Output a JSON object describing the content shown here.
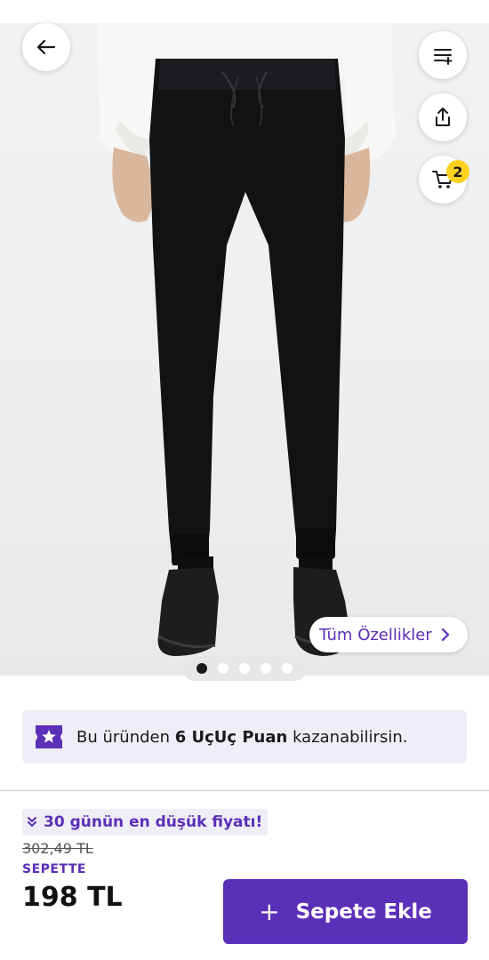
{
  "header": {
    "back_icon": "arrow-left-icon",
    "filter_icon": "list-add-icon",
    "share_icon": "share-icon",
    "cart_icon": "cart-icon",
    "cart_count": "2"
  },
  "gallery": {
    "specs_label": "Tüm Özellikler",
    "image_count": 5,
    "active_index": 0
  },
  "points": {
    "prefix": "Bu üründen ",
    "amount": "6 UçUç Puan",
    "suffix": " kazanabilirsin."
  },
  "pricing": {
    "lowest_label": "30 günün en düşük fiyatı!",
    "old_price": "302,49 TL",
    "cart_label": "SEPETTE",
    "price": "198 TL"
  },
  "cta": {
    "add_label": "Sepete Ekle"
  },
  "colors": {
    "accent": "#5b2fb8",
    "badge": "#ffd21f"
  }
}
